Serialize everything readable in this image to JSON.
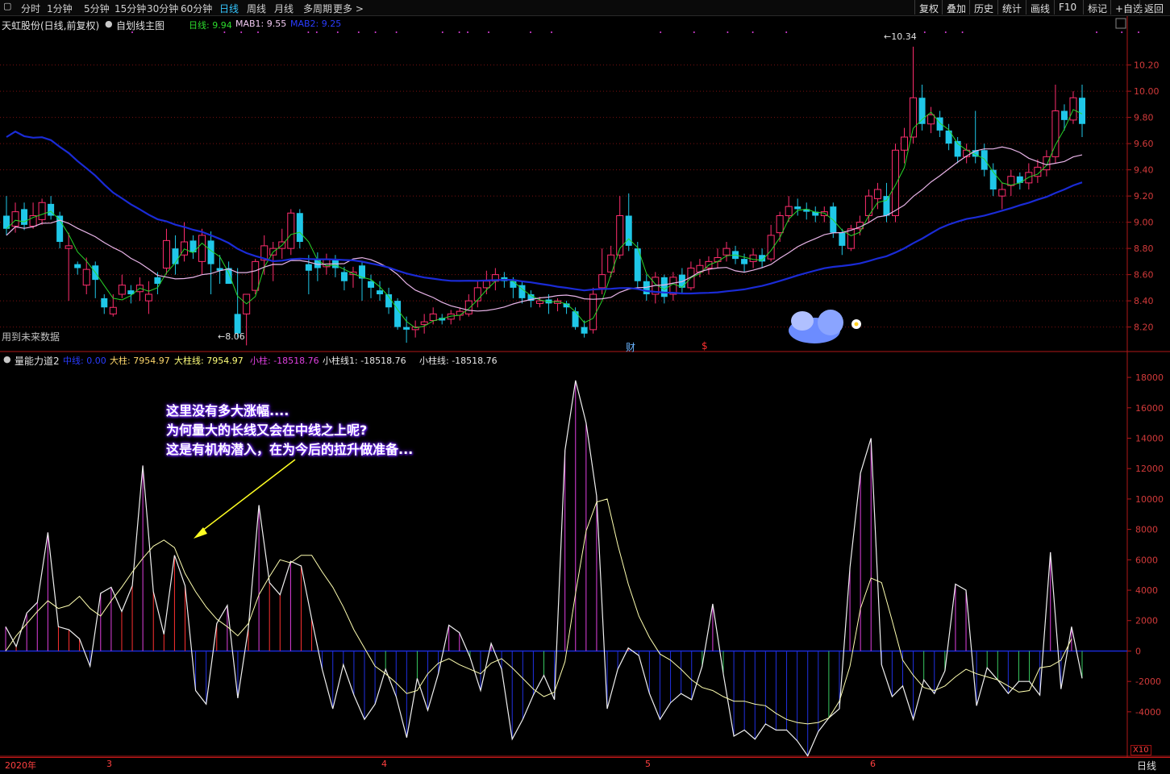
{
  "toolbar": {
    "periods": [
      "分时",
      "1分钟",
      "5分钟",
      "15分钟",
      "30分钟",
      "60分钟",
      "日线",
      "周线",
      "月线",
      "多周期",
      "更多 >"
    ],
    "active_period": "日线",
    "right_buttons": [
      "复权",
      "叠加",
      "历史",
      "统计",
      "画线",
      "F10",
      "标记",
      "+自选",
      "返回"
    ]
  },
  "main_panel": {
    "stock_label": "天虹股份(日线,前复权)",
    "indicator_name": "自划线主图",
    "legend": {
      "day": "日线: 9.94",
      "mab1": "MAB1: 9.55",
      "mab2": "MAB2: 9.25"
    },
    "high_label": "10.34",
    "low_label": "8.06",
    "future_note": "用到未来数据",
    "marker_cai": "财",
    "marker_dollar": "$"
  },
  "sub_panel": {
    "indicator_name": "量能力道2",
    "legend": {
      "mid": "中线: 0.00",
      "big": "大柱: 7954.97",
      "bigline": "大柱线: 7954.97",
      "small": "小柱: -18518.76",
      "smallline1": "小柱线1: -18518.76",
      "smallline": "小柱线: -18518.76"
    },
    "zoom_label": "X10"
  },
  "annotation": [
    "这里没有多大涨幅....",
    "为何量大的长线又会在中线之上呢?",
    "这是有机构潜入，在为今后的拉升做准备..."
  ],
  "bottom": {
    "year_label": "2020年",
    "month_labels": [
      "3",
      "4",
      "5",
      "6"
    ],
    "period_label": "日线"
  },
  "colors": {
    "up": "#ff2d6e",
    "down": "#1fc7e8",
    "ma_green": "#29d429",
    "ma_pink": "#e8b4e8",
    "ma_blue": "#1a2bd6",
    "grid": "#7a1010",
    "axis_text": "#d23a3a",
    "arrow": "#ffff22"
  },
  "chart_data": [
    {
      "type": "candlestick",
      "title": "天虹股份(日线,前复权)",
      "y_ticks": [
        8.2,
        8.4,
        8.6,
        8.8,
        9.0,
        9.2,
        9.4,
        9.6,
        9.8,
        10.0,
        10.2
      ],
      "ylim": [
        8.05,
        10.45
      ],
      "x_month_labels": [
        "2020年",
        "3",
        "4",
        "5",
        "6"
      ],
      "candles": [
        [
          9.05,
          8.95,
          9.2,
          8.9
        ],
        [
          8.97,
          9.08,
          9.15,
          8.92
        ],
        [
          9.1,
          8.98,
          9.15,
          8.94
        ],
        [
          8.97,
          9.05,
          9.15,
          8.95
        ],
        [
          9.02,
          9.15,
          9.18,
          8.98
        ],
        [
          9.14,
          9.05,
          9.2,
          9.02
        ],
        [
          9.05,
          8.85,
          9.08,
          8.8
        ],
        [
          8.8,
          8.82,
          8.92,
          8.4
        ],
        [
          8.68,
          8.65,
          8.7,
          8.6
        ],
        [
          8.52,
          8.64,
          8.73,
          8.45
        ],
        [
          8.67,
          8.56,
          8.7,
          8.42
        ],
        [
          8.42,
          8.35,
          8.45,
          8.3
        ],
        [
          8.3,
          8.35,
          8.45,
          8.28
        ],
        [
          8.45,
          8.52,
          8.6,
          8.42
        ],
        [
          8.48,
          8.45,
          8.52,
          8.38
        ],
        [
          8.47,
          8.52,
          8.58,
          8.4
        ],
        [
          8.4,
          8.45,
          8.55,
          8.3
        ],
        [
          8.58,
          8.53,
          8.62,
          8.45
        ],
        [
          8.65,
          8.86,
          8.95,
          8.6
        ],
        [
          8.8,
          8.68,
          8.9,
          8.6
        ],
        [
          8.75,
          8.85,
          9.0,
          8.7
        ],
        [
          8.86,
          8.77,
          8.9,
          8.72
        ],
        [
          8.7,
          8.9,
          8.95,
          8.6
        ],
        [
          8.86,
          8.68,
          8.93,
          8.45
        ],
        [
          8.65,
          8.63,
          8.75,
          8.53
        ],
        [
          8.65,
          8.53,
          8.7,
          8.55
        ],
        [
          8.3,
          8.15,
          8.65,
          8.12
        ],
        [
          8.3,
          8.45,
          8.45,
          8.06
        ],
        [
          8.48,
          8.7,
          8.72,
          8.45
        ],
        [
          8.71,
          8.82,
          8.9,
          8.6
        ],
        [
          8.75,
          8.8,
          8.85,
          8.55
        ],
        [
          8.8,
          8.85,
          8.95,
          8.72
        ],
        [
          8.8,
          9.07,
          9.1,
          8.75
        ],
        [
          9.07,
          8.85,
          9.1,
          8.8
        ],
        [
          8.68,
          8.63,
          8.75,
          8.45
        ],
        [
          8.72,
          8.65,
          8.77,
          8.55
        ],
        [
          8.66,
          8.72,
          8.76,
          8.6
        ],
        [
          8.72,
          8.65,
          8.75,
          8.58
        ],
        [
          8.62,
          8.55,
          8.66,
          8.48
        ],
        [
          8.6,
          8.62,
          8.66,
          8.5
        ],
        [
          8.67,
          8.57,
          8.7,
          8.4
        ],
        [
          8.55,
          8.5,
          8.6,
          8.42
        ],
        [
          8.48,
          8.45,
          8.55,
          8.4
        ],
        [
          8.45,
          8.35,
          8.5,
          8.3
        ],
        [
          8.4,
          8.2,
          8.42,
          8.18
        ],
        [
          8.2,
          8.18,
          8.28,
          8.08
        ],
        [
          8.18,
          8.2,
          8.25,
          8.12
        ],
        [
          8.22,
          8.24,
          8.3,
          8.15
        ],
        [
          8.25,
          8.3,
          8.35,
          8.22
        ],
        [
          8.27,
          8.25,
          8.3,
          8.22
        ],
        [
          8.26,
          8.3,
          8.33,
          8.22
        ],
        [
          8.29,
          8.32,
          8.35,
          8.25
        ],
        [
          8.3,
          8.4,
          8.45,
          8.28
        ],
        [
          8.4,
          8.5,
          8.55,
          8.35
        ],
        [
          8.5,
          8.55,
          8.63,
          8.45
        ],
        [
          8.55,
          8.6,
          8.65,
          8.48
        ],
        [
          8.58,
          8.55,
          8.62,
          8.5
        ],
        [
          8.55,
          8.5,
          8.58,
          8.42
        ],
        [
          8.52,
          8.42,
          8.55,
          8.38
        ],
        [
          8.45,
          8.4,
          8.48,
          8.35
        ],
        [
          8.38,
          8.4,
          8.43,
          8.35
        ],
        [
          8.41,
          8.38,
          8.45,
          8.3
        ],
        [
          8.38,
          8.4,
          8.42,
          8.32
        ],
        [
          8.38,
          8.35,
          8.4,
          8.3
        ],
        [
          8.32,
          8.2,
          8.35,
          8.18
        ],
        [
          8.2,
          8.15,
          8.25,
          8.12
        ],
        [
          8.18,
          8.45,
          8.5,
          8.15
        ],
        [
          8.5,
          8.6,
          8.8,
          8.45
        ],
        [
          8.62,
          8.75,
          8.82,
          8.58
        ],
        [
          8.75,
          9.05,
          9.2,
          8.72
        ],
        [
          9.05,
          8.82,
          9.22,
          8.78
        ],
        [
          8.8,
          8.55,
          8.85,
          8.5
        ],
        [
          8.55,
          8.45,
          8.6,
          8.4
        ],
        [
          8.45,
          8.58,
          8.62,
          8.38
        ],
        [
          8.58,
          8.43,
          8.6,
          8.38
        ],
        [
          8.45,
          8.58,
          8.62,
          8.4
        ],
        [
          8.6,
          8.5,
          8.65,
          8.45
        ],
        [
          8.5,
          8.65,
          8.7,
          8.48
        ],
        [
          8.62,
          8.67,
          8.72,
          8.58
        ],
        [
          8.65,
          8.7,
          8.74,
          8.6
        ],
        [
          8.7,
          8.73,
          8.8,
          8.65
        ],
        [
          8.75,
          8.8,
          8.85,
          8.7
        ],
        [
          8.78,
          8.72,
          8.82,
          8.68
        ],
        [
          8.72,
          8.68,
          8.76,
          8.62
        ],
        [
          8.7,
          8.75,
          8.8,
          8.65
        ],
        [
          8.75,
          8.7,
          8.8,
          8.65
        ],
        [
          8.72,
          8.9,
          8.98,
          8.7
        ],
        [
          8.92,
          9.05,
          9.08,
          8.85
        ],
        [
          9.05,
          9.12,
          9.2,
          9.0
        ],
        [
          9.12,
          9.1,
          9.18,
          9.05
        ],
        [
          9.1,
          9.08,
          9.15,
          9.02
        ],
        [
          9.08,
          9.05,
          9.12,
          9.0
        ],
        [
          9.05,
          9.08,
          9.12,
          9.0
        ],
        [
          9.12,
          8.92,
          9.15,
          8.88
        ],
        [
          8.92,
          8.82,
          8.95,
          8.75
        ],
        [
          8.8,
          8.95,
          8.98,
          8.78
        ],
        [
          8.95,
          9.0,
          9.05,
          8.9
        ],
        [
          9.05,
          9.2,
          9.25,
          9.0
        ],
        [
          9.18,
          9.25,
          9.3,
          9.1
        ],
        [
          9.2,
          9.05,
          9.3,
          9.0
        ],
        [
          9.05,
          9.55,
          9.6,
          9.0
        ],
        [
          9.55,
          9.65,
          9.72,
          9.45
        ],
        [
          9.65,
          9.95,
          10.34,
          9.6
        ],
        [
          9.95,
          9.75,
          10.05,
          9.7
        ],
        [
          9.75,
          9.82,
          9.88,
          9.68
        ],
        [
          9.8,
          9.7,
          9.85,
          9.65
        ],
        [
          9.7,
          9.6,
          9.75,
          9.55
        ],
        [
          9.62,
          9.5,
          9.65,
          9.45
        ],
        [
          9.5,
          9.55,
          9.6,
          9.45
        ],
        [
          9.55,
          9.5,
          9.85,
          9.45
        ],
        [
          9.55,
          9.4,
          9.6,
          9.35
        ],
        [
          9.4,
          9.25,
          9.45,
          9.2
        ],
        [
          9.2,
          9.25,
          9.3,
          9.1
        ],
        [
          9.28,
          9.35,
          9.4,
          9.2
        ],
        [
          9.35,
          9.3,
          9.38,
          9.25
        ],
        [
          9.3,
          9.38,
          9.45,
          9.25
        ],
        [
          9.35,
          9.42,
          9.48,
          9.3
        ],
        [
          9.4,
          9.5,
          9.55,
          9.35
        ],
        [
          9.5,
          9.85,
          10.05,
          9.45
        ],
        [
          9.85,
          9.78,
          9.9,
          9.7
        ],
        [
          9.78,
          9.95,
          10.0,
          9.75
        ],
        [
          9.95,
          9.75,
          10.05,
          9.65
        ]
      ]
    },
    {
      "type": "bar",
      "title": "量能力道2",
      "y_ticks": [
        -4000,
        -2000,
        0,
        2000,
        4000,
        6000,
        8000,
        10000,
        12000,
        14000,
        16000,
        18000
      ],
      "ylim": [
        -6500,
        18800
      ],
      "values": [
        1600,
        300,
        2500,
        3200,
        7800,
        1600,
        1400,
        800,
        -1000,
        3800,
        4200,
        2600,
        4300,
        12200,
        3900,
        1100,
        6300,
        4300,
        -2600,
        -3500,
        1800,
        3000,
        -3100,
        1500,
        9600,
        4500,
        3700,
        5900,
        5600,
        2100,
        -1200,
        -3800,
        -900,
        -2900,
        -4500,
        -3500,
        -1200,
        -3000,
        -5700,
        -1800,
        -3900,
        -1500,
        1700,
        1200,
        -400,
        -2600,
        500,
        -1200,
        -5800,
        -4500,
        -2900,
        -1600,
        -3200,
        13200,
        17800,
        15000,
        10200,
        -3800,
        -1200,
        200,
        -300,
        -2800,
        -4500,
        -3400,
        -2800,
        -3200,
        -1000,
        3100,
        -1500,
        -5600,
        -5200,
        -5800,
        -4800,
        -5200,
        -5200,
        -5900,
        -6900,
        -5300,
        -4400,
        -3800,
        5500,
        11700,
        14000,
        -900,
        -3000,
        -2300,
        -4500,
        -1900,
        -2800,
        -1300,
        4400,
        4000,
        -3600,
        -1100,
        -1900,
        -2800,
        -2000,
        -2000,
        -2900,
        6500,
        -2500,
        1600,
        -1800
      ],
      "series_line_big": [
        0,
        1000,
        1800,
        2600,
        3300,
        2800,
        3000,
        3600,
        2800,
        2300,
        3300,
        4200,
        5200,
        6100,
        6900,
        7300,
        6800,
        5100,
        3900,
        2900,
        2100,
        1600,
        1000,
        1800,
        3700,
        4900,
        6000,
        5800,
        6300,
        6300,
        5200,
        4200,
        2900,
        1400,
        200,
        -1000,
        -1500,
        -2100,
        -2800,
        -2600,
        -1500,
        -800,
        -500,
        -900,
        -1200,
        -1500,
        -800,
        -500,
        -1100,
        -1800,
        -2500,
        -3000,
        -2700,
        -700,
        3800,
        7900,
        9800,
        10000,
        7000,
        4400,
        2300,
        900,
        -200,
        -600,
        -1200,
        -1900,
        -2400,
        -2600,
        -3000,
        -3300,
        -3300,
        -3500,
        -3600,
        -4100,
        -4500,
        -4700,
        -4800,
        -4700,
        -4400,
        -3300,
        -1000,
        2800,
        4800,
        4500,
        2000,
        -600,
        -1600,
        -2400,
        -2600,
        -2300,
        -1700,
        -1200,
        -1500,
        -1700,
        -1900,
        -2300,
        -2700,
        -2600,
        -1100,
        -1000,
        -600,
        800
      ]
    }
  ]
}
